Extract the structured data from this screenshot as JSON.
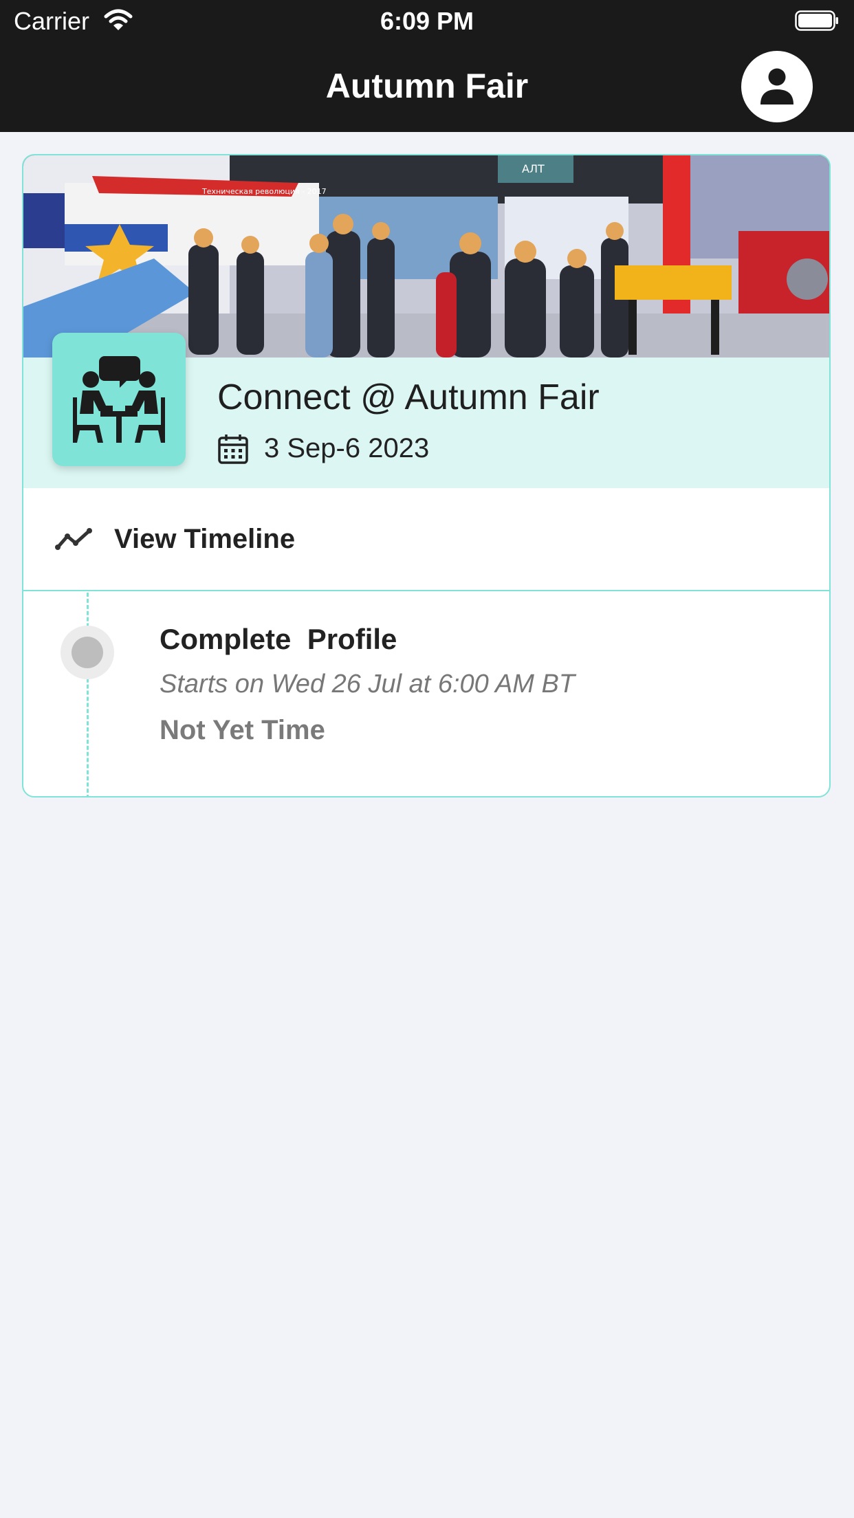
{
  "status_bar": {
    "carrier": "Carrier",
    "time": "6:09 PM"
  },
  "nav": {
    "title": "Autumn Fair",
    "profile_icon": "person-icon"
  },
  "event": {
    "banner_sign": "Техническая революция - 2017",
    "banner_stand": "АЛТ",
    "title": "Connect @ Autumn Fair",
    "date": "3 Sep-6 2023",
    "icon": "meeting-icon"
  },
  "timeline_link": {
    "label": "View Timeline",
    "icon": "trend-line-icon"
  },
  "timeline": [
    {
      "title": "Complete  Profile",
      "start": "Starts on Wed 26 Jul at 6:00 AM BT",
      "status": "Not Yet Time"
    }
  ],
  "colors": {
    "accent": "#7fe3d8",
    "header_bg": "#dcf7f3",
    "nav_bg": "#1a1a1a",
    "page_bg": "#f2f3f8"
  }
}
